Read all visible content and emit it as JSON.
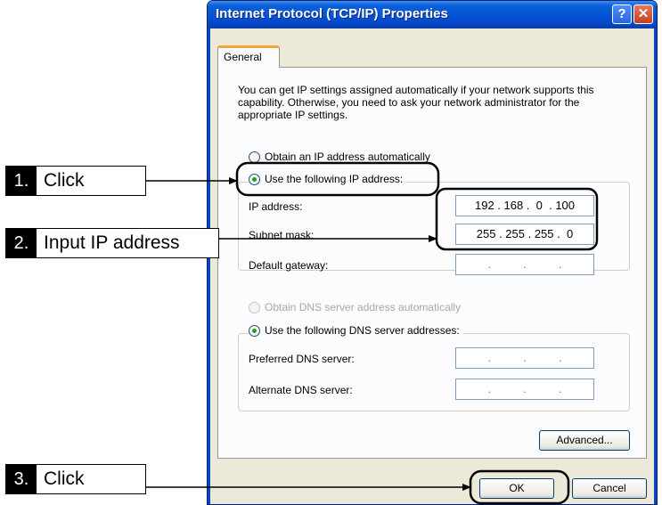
{
  "dialog": {
    "title": "Internet Protocol (TCP/IP) Properties",
    "help_label": "?",
    "close_label": "✕",
    "tab_general": "General",
    "description": "You can get IP settings assigned automatically if your network supports this capability. Otherwise, you need to ask your network administrator for the appropriate IP settings.",
    "ip_options": {
      "auto_label": "Obtain an IP address automatically",
      "manual_label": "Use the following IP address:",
      "selected": "manual"
    },
    "ip_fields": {
      "ip_address_label": "IP address:",
      "ip_address_value": "192 . 168 .  0  . 100",
      "subnet_mask_label": "Subnet mask:",
      "subnet_mask_value": "255 . 255 . 255 .  0",
      "gateway_label": "Default gateway:",
      "gateway_value": ".          .          ."
    },
    "dns_options": {
      "auto_label": "Obtain DNS server address automatically",
      "manual_label": "Use the following DNS server addresses:",
      "selected": "manual"
    },
    "dns_fields": {
      "preferred_label": "Preferred DNS server:",
      "preferred_value": ".          .          .",
      "alternate_label": "Alternate DNS server:",
      "alternate_value": ".          .          ."
    },
    "buttons": {
      "advanced": "Advanced...",
      "ok": "OK",
      "cancel": "Cancel"
    }
  },
  "annotations": {
    "step1": {
      "number": "1.",
      "text": "Click"
    },
    "step2": {
      "number": "2.",
      "text": "Input IP address"
    },
    "step3": {
      "number": "3.",
      "text": "Click"
    }
  },
  "colors": {
    "titlebar": "#0653d6",
    "dialog_bg": "#ece9d8",
    "radio_checked": "#21a121",
    "close_button": "#c4401e"
  }
}
